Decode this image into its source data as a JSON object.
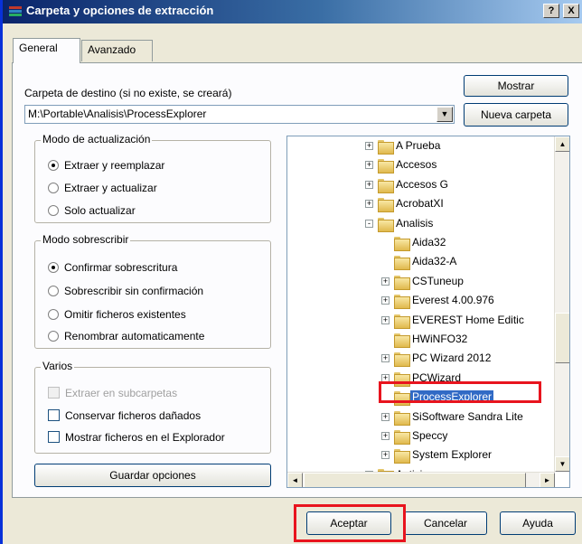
{
  "window": {
    "title": "Carpeta y opciones de extracción"
  },
  "titlebar": {
    "help_label": "?",
    "close_label": "X"
  },
  "tabs": [
    {
      "label": "General",
      "active": true
    },
    {
      "label": "Avanzado",
      "active": false
    }
  ],
  "destination": {
    "label": "Carpeta de destino (si no existe, se creará)",
    "path_value": "M:\\Portable\\Analisis\\ProcessExplorer",
    "show_button": "Mostrar",
    "new_folder_button": "Nueva carpeta"
  },
  "update_mode": {
    "title": "Modo de actualización",
    "options": [
      {
        "label": "Extraer y reemplazar",
        "selected": true
      },
      {
        "label": "Extraer y actualizar",
        "selected": false
      },
      {
        "label": "Solo actualizar",
        "selected": false
      }
    ]
  },
  "overwrite_mode": {
    "title": "Modo sobrescribir",
    "options": [
      {
        "label": "Confirmar sobrescritura",
        "selected": true
      },
      {
        "label": "Sobrescribir sin confirmación",
        "selected": false
      },
      {
        "label": "Omitir ficheros existentes",
        "selected": false
      },
      {
        "label": "Renombrar automaticamente",
        "selected": false
      }
    ]
  },
  "misc": {
    "title": "Varios",
    "options": [
      {
        "label": "Extraer en subcarpetas",
        "checked": false,
        "disabled": true
      },
      {
        "label": "Conservar ficheros dañados",
        "checked": false,
        "disabled": false
      },
      {
        "label": "Mostrar ficheros en el Explorador",
        "checked": false,
        "disabled": false
      }
    ]
  },
  "save_options_button": "Guardar opciones",
  "tree": {
    "nodes": [
      {
        "label": "A Prueba",
        "expander": "+"
      },
      {
        "label": "Accesos",
        "expander": "+"
      },
      {
        "label": "Accesos G",
        "expander": "+"
      },
      {
        "label": "AcrobatXI",
        "expander": "+"
      },
      {
        "label": "Analisis",
        "expander": "-"
      },
      {
        "label": "Aida32",
        "expander": ""
      },
      {
        "label": "Aida32-A",
        "expander": ""
      },
      {
        "label": "CSTuneup",
        "expander": "+"
      },
      {
        "label": "Everest 4.00.976",
        "expander": "+"
      },
      {
        "label": "EVEREST Home Editic",
        "expander": "+"
      },
      {
        "label": "HWiNFO32",
        "expander": ""
      },
      {
        "label": "PC Wizard 2012",
        "expander": "+"
      },
      {
        "label": "PCWizard",
        "expander": "+"
      },
      {
        "label": "ProcessExplorer",
        "expander": "",
        "selected": true
      },
      {
        "label": "SiSoftware Sandra Lite",
        "expander": "+"
      },
      {
        "label": "Speccy",
        "expander": "+"
      },
      {
        "label": "System Explorer",
        "expander": "+"
      },
      {
        "label": "Antivirus",
        "expander": "+"
      }
    ]
  },
  "footer": {
    "ok_button": "Aceptar",
    "cancel_button": "Cancelar",
    "help_button": "Ayuda"
  },
  "colors": {
    "highlight": "#e8141e",
    "selection": "#316ac5",
    "title_bar": "#0a246a"
  }
}
